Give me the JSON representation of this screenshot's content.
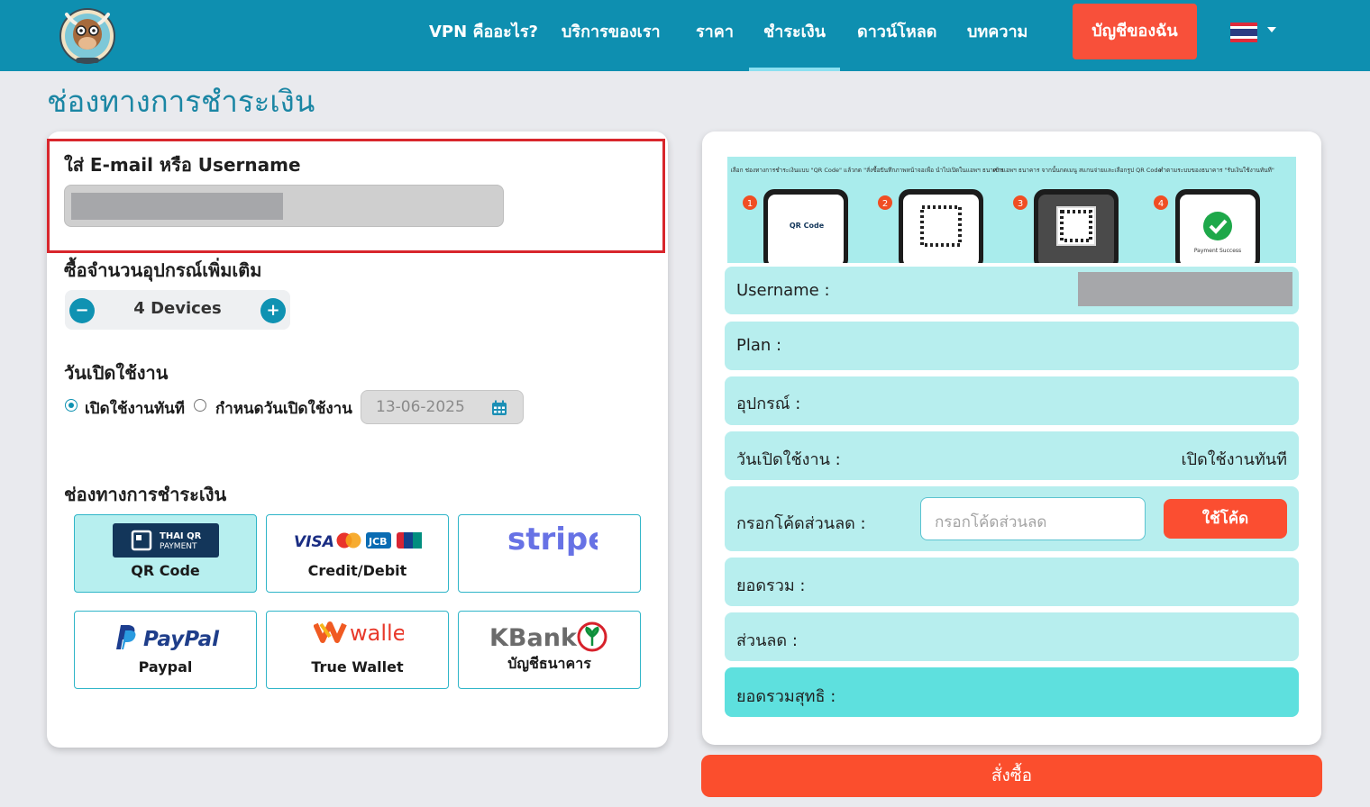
{
  "header": {
    "nav": [
      "VPN คืออะไร?",
      "บริการของเรา",
      "ราคา",
      "ชำระเงิน",
      "ดาวน์โหลด",
      "บทความ"
    ],
    "account_button": "บัญชีของฉัน",
    "brand_color": "#0e8fb0",
    "logo_icon": "bull-mascot-logo",
    "language_icon": "thai-flag-icon"
  },
  "page": {
    "title": "ช่องทางการชำระเงิน"
  },
  "form": {
    "email_label": "ใส่ E-mail หรือ Username",
    "devices_label": "ซื้อจำนวนอุปกรณ์เพิ่มเติม",
    "devices_value": "4 Devices",
    "minus": "−",
    "plus": "+",
    "start_label": "วันเปิดใช้งาน",
    "start_now": "เปิดใช้งานทันที",
    "start_scheduled": "กำหนดวันเปิดใช้งาน",
    "date_value": "13-06-2025",
    "payment_label": "ช่องทางการชำระเงิน"
  },
  "payment_methods": [
    {
      "name": "QR Code",
      "logo": "thai-qr-payment-logo",
      "logo_text": [
        "THAI QR",
        "PAYMENT"
      ]
    },
    {
      "name": "Credit/Debit",
      "logo": "visa-mastercard-jcb-unionpay-logos",
      "logo_text": [
        "VISA",
        "JCB"
      ]
    },
    {
      "name": "",
      "logo": "stripe-logo",
      "logo_text": [
        "stripe"
      ]
    },
    {
      "name": "Paypal",
      "logo": "paypal-logo",
      "logo_text": [
        "PayPal"
      ]
    },
    {
      "name": "True Wallet",
      "logo": "true-wallet-logo",
      "logo_text": [
        "wallet"
      ]
    },
    {
      "name": "บัญชีธนาคาร",
      "logo": "kbank-logo",
      "logo_text": [
        "KBank"
      ]
    }
  ],
  "summary": {
    "username_label": "Username :",
    "plan_label": "Plan :",
    "device_label": "อุปกรณ์ :",
    "start_label": "วันเปิดใช้งาน :",
    "start_value": "เปิดใช้งานทันที",
    "coupon_label": "กรอกโค้ดส่วนลด :",
    "coupon_placeholder": "กรอกโค้ดส่วนลด",
    "coupon_button": "ใช้โค้ด",
    "total_label": "ยอดรวม :",
    "discount_label": "ส่วนลด :",
    "net_label": "ยอดรวมสุทธิ :"
  },
  "qr_steps": [
    {
      "number": "1",
      "caption": "เลือก ช่องทางการชำระเงินแบบ \"QR Code\" แล้วกด \"สั่งซื้อ\"",
      "screen": "QR Code"
    },
    {
      "number": "2",
      "caption": "บันทึกภาพหน้าจอเพื่อ นำไปเปิดในแอพฯ ธนาคาร",
      "screen": ""
    },
    {
      "number": "3",
      "caption": "เข้าแอพฯ ธนาคาร จากนั้นกดเมนู สแกนจ่ายและเลือกรูป QR Code",
      "screen": ""
    },
    {
      "number": "4",
      "caption": "ทำตามระบบของธนาคาร \"รับเงินใช้งานทันที\"",
      "screen": "Payment Success"
    }
  ],
  "order_button": "สั่งซื้อ"
}
